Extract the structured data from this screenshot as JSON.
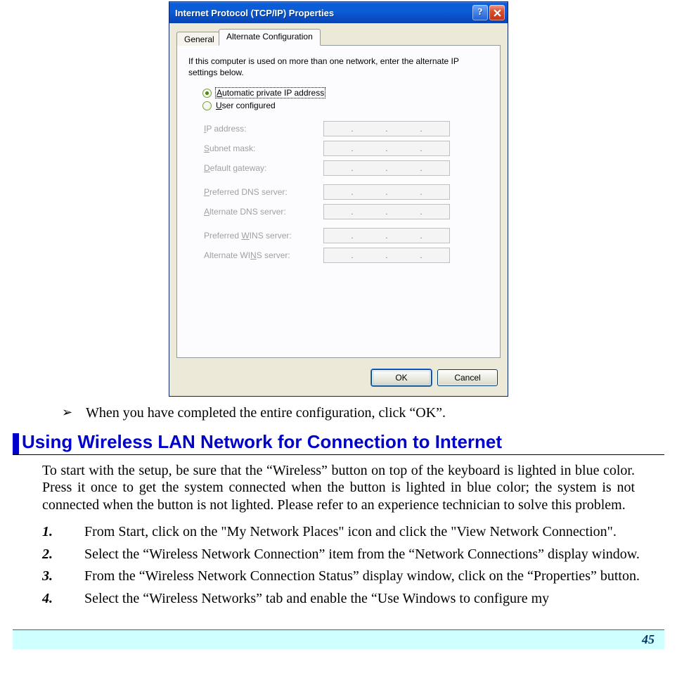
{
  "dialog": {
    "title": "Internet Protocol (TCP/IP) Properties",
    "tab_general": "General",
    "tab_alt": "Alternate Configuration",
    "intro": "If this computer is used on more than one network, enter the alternate IP settings below.",
    "radio_auto_pre": "A",
    "radio_auto_post": "utomatic private IP address",
    "radio_user_pre": "U",
    "radio_user_post": "ser configured",
    "fields": {
      "ip_pre": "I",
      "ip_label_post": "P address:",
      "subnet_pre": "S",
      "subnet_post": "ubnet mask:",
      "gateway_pre": "D",
      "gateway_post": "efault gateway:",
      "pdns_pre": "P",
      "pdns_post": "referred DNS server:",
      "adns_pre": "A",
      "adns_post": "lternate DNS server:",
      "pwins_pre": "Preferred ",
      "pwins_u": "W",
      "pwins_post": "INS server:",
      "awins_pre": "Alternate WI",
      "awins_u": "N",
      "awins_post": "S server:"
    },
    "ok": "OK",
    "cancel": "Cancel"
  },
  "bullet": "When you have completed the entire configuration, click “OK”.",
  "section_heading": "Using Wireless LAN Network for Connection to Internet",
  "paragraph": "To start with the setup, be sure that the “Wireless” button on top of the keyboard is lighted in blue color. Press it once to get the system connected when the button is lighted in blue color; the system is not connected when the button is not lighted. Please refer to an experience technician to solve this problem.",
  "list": [
    {
      "n": "1.",
      "t": "From Start, click on the \"My Network Places\" icon and click the \"View Network Connection\"."
    },
    {
      "n": "2.",
      "t": "Select the “Wireless Network Connection” item from the “Network Connections” display window."
    },
    {
      "n": "3.",
      "t": "From the “Wireless Network Connection Status” display window, click on the “Properties” button."
    },
    {
      "n": "4.",
      "t": "Select the “Wireless Networks” tab and enable the “Use Windows to configure my"
    }
  ],
  "page_number": "45"
}
